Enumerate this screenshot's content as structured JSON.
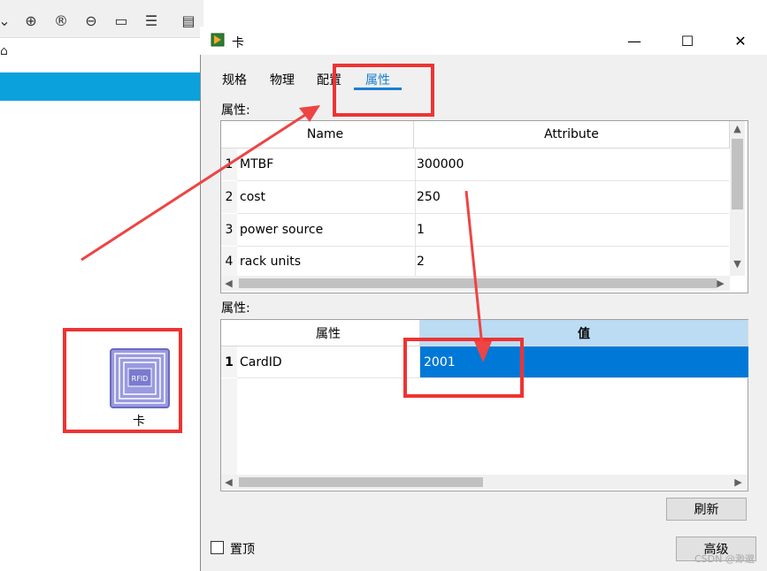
{
  "dialog": {
    "title": "卡",
    "minimize": "—",
    "maximize": "☐",
    "close": "✕",
    "tabs": [
      "规格",
      "物理",
      "配置",
      "属性"
    ],
    "active_tab": "属性",
    "section1_label": "属性:",
    "table1": {
      "headers": [
        "Name",
        "Attribute"
      ],
      "rows": [
        {
          "num": "1",
          "name": "MTBF",
          "value": "300000"
        },
        {
          "num": "2",
          "name": "cost",
          "value": "250"
        },
        {
          "num": "3",
          "name": "power source",
          "value": "1"
        },
        {
          "num": "4",
          "name": "rack units",
          "value": "2"
        }
      ]
    },
    "section2_label": "属性:",
    "table2": {
      "headers": [
        "属性",
        "值"
      ],
      "rows": [
        {
          "num": "1",
          "name": "CardID",
          "value": "2001"
        }
      ]
    },
    "refresh_button": "刷新",
    "topmost_label": "置顶",
    "advanced_button": "高级"
  },
  "canvas": {
    "device_label": "卡",
    "device_icon_text": "RFID"
  },
  "watermark": "CSDN @渺邈",
  "colors": {
    "accent_blue": "#0078d7",
    "tab_blue": "#1a7fd0",
    "header_selected": "#bcdcf4",
    "annotation_red": "#ee3333",
    "bluebar": "#0aa1dd"
  }
}
